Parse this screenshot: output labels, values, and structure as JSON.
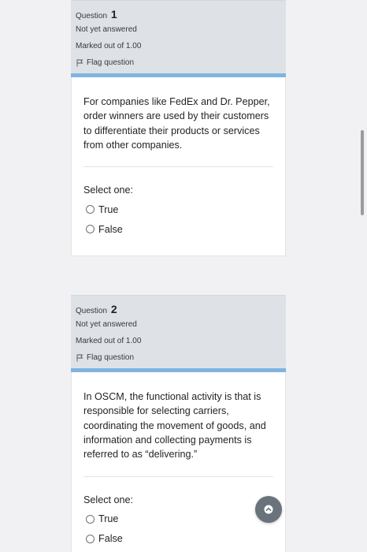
{
  "questions": [
    {
      "title_prefix": "Question",
      "number": "1",
      "status": "Not yet answered",
      "marks": "Marked out of 1.00",
      "flag_label": "Flag question",
      "text": "For companies like FedEx and Dr. Pepper, order winners are used by their customers to differentiate their products or services from other companies.",
      "select_label": "Select one:",
      "options": [
        "True",
        "False"
      ]
    },
    {
      "title_prefix": "Question",
      "number": "2",
      "status": "Not yet answered",
      "marks": "Marked out of 1.00",
      "flag_label": "Flag question",
      "text": "In OSCM, the functional activity is that is responsible for selecting carriers, coordinating the movement of goods, and information and collecting payments is referred to as “delivering.”",
      "select_label": "Select one:",
      "options": [
        "True",
        "False"
      ]
    }
  ],
  "icons": {
    "flag": "flag-icon",
    "back_to_top": "chevron-up-icon"
  },
  "colors": {
    "info_background": "#dee2e6",
    "info_bar": "#7fb4e0",
    "back_to_top": "#6a737b"
  }
}
